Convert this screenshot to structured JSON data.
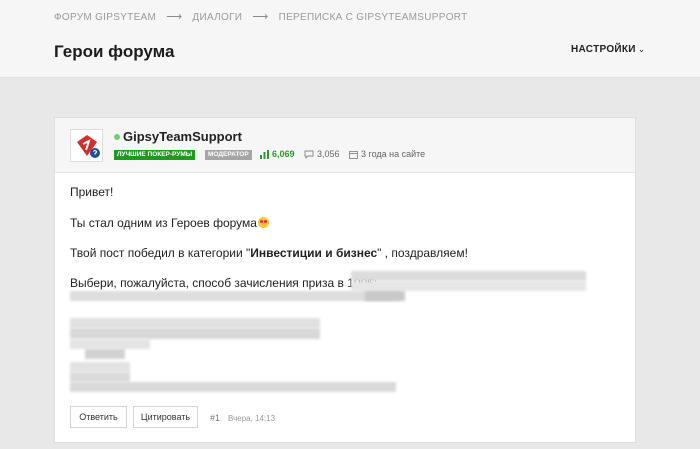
{
  "header": {
    "breadcrumb": [
      "ФОРУМ GIPSYTEAM",
      "ДИАЛОГИ",
      "ПЕРЕПИСКА С GIPSYTEAMSUPPORT"
    ],
    "breadcrumb_sep": "⟶",
    "title": "Герои форума",
    "settings_label": "НАСТРОЙКИ",
    "settings_chevron": "⌄"
  },
  "post": {
    "author": {
      "name": "GipsyTeamSupport",
      "online": true,
      "badge_group": "ЛУЧШИЕ ПОКЕР-РУМЫ",
      "badge_role": "МОДЕРАТОР",
      "reputation": "6,069",
      "messages": "3,056",
      "age": "3 года на сайте"
    },
    "content": {
      "greeting": "Привет!",
      "hero_line": "Ты стал одним из Героев форума",
      "win_before": "Твой пост победил в категории \"",
      "win_category": "Инвестиции и бизнес",
      "win_after": "\" , поздравляем!",
      "prize_line": "Выбери, пожалуйста, способ зачисления приза в 100$:"
    },
    "actions": {
      "reply_label": "Ответить",
      "quote_label": "Цитировать"
    },
    "number": "#1",
    "time": "Вчера, 14:13"
  },
  "colors": {
    "online": "#6fcf6f",
    "badge_group": "#1e9a1e",
    "badge_role": "#a5a5a5",
    "reputation": "#2c9a2c"
  }
}
